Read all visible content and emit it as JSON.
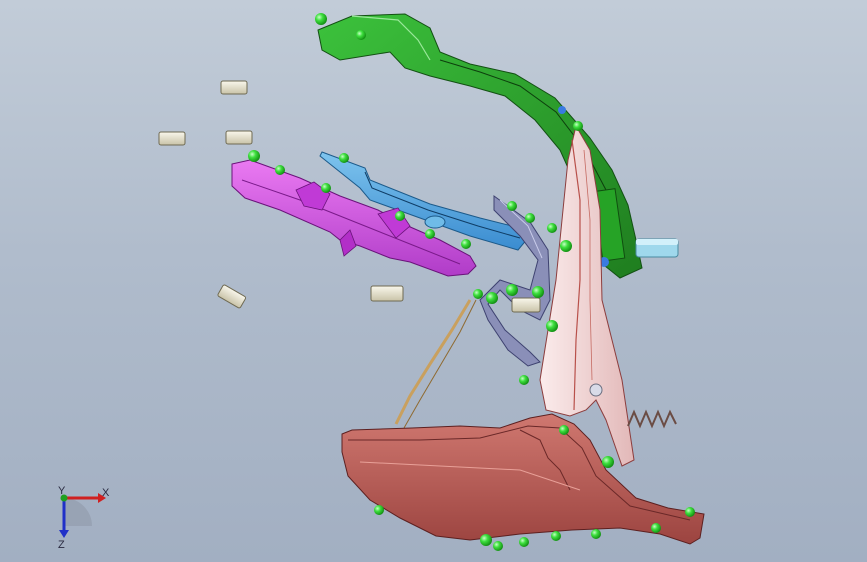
{
  "viewport": {
    "background_top": "#c2ccd8",
    "background_bottom": "#a2afc2"
  },
  "parts": [
    {
      "name": "green-bracket",
      "color": "#2aa52a"
    },
    {
      "name": "magenta-bracket",
      "color": "#d24fe0"
    },
    {
      "name": "blue-bracket",
      "color": "#4da6e0"
    },
    {
      "name": "light-pink-arm",
      "color": "#f2d6d6"
    },
    {
      "name": "brown-base-plate",
      "color": "#b85a55"
    },
    {
      "name": "slate-hinge",
      "color": "#8488b0"
    },
    {
      "name": "cyan-pin",
      "color": "#9fd8ec"
    },
    {
      "name": "spring",
      "color": "#7a5c52"
    },
    {
      "name": "tan-wire",
      "color": "#c9a05e"
    },
    {
      "name": "spacer-bushing",
      "color": "#f3efdc"
    }
  ],
  "point_color": "#33e033",
  "triad": {
    "x_label": "X",
    "y_label": "Y",
    "z_label": "Z"
  }
}
